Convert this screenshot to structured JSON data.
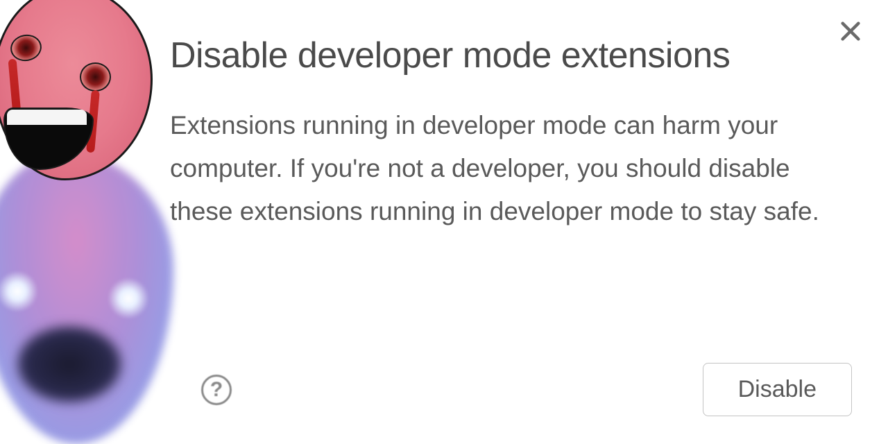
{
  "dialog": {
    "title": "Disable developer mode extensions",
    "body": "Extensions running in developer mode can harm your computer. If you're not a developer, you should disable these extensions running in developer mode to stay safe.",
    "disable_label": "Disable"
  },
  "icons": {
    "close": "close-icon",
    "help": "help-icon"
  }
}
